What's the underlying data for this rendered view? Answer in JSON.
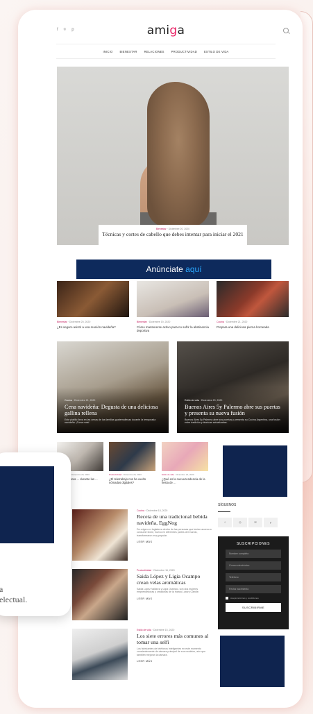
{
  "site": {
    "logo_prefix": "ami",
    "logo_accent": "g",
    "logo_suffix": "a",
    "social": [
      "f",
      "⌾",
      "p"
    ],
    "nav": [
      "INICIO",
      "BIENESTAR",
      "RELACIONES",
      "PRODUCTIVIDAD",
      "ESTILO DE VIDA"
    ]
  },
  "hero": {
    "category": "Bienestar",
    "date": "Diciembre 20, 2020",
    "title": "Técnicas y cortes de cabello que debes intentar para iniciar el 2021"
  },
  "ad_banner": {
    "text": "Anúnciate",
    "accent": "aquí"
  },
  "triple": [
    {
      "category": "Bienestar",
      "date": "Diciembre 20, 2020",
      "title": "¿Es seguro asistir a una reunión navideña?"
    },
    {
      "category": "Bienestar",
      "date": "Diciembre 19, 2020",
      "title": "Cómo mantenerse activo para no sufrir la abstinencia deportiva"
    },
    {
      "category": "Cocina",
      "date": "Diciembre 21, 2020",
      "title": "Prepara una deliciosa pierna horneada"
    }
  ],
  "big": [
    {
      "category": "Cocina",
      "date": "Diciembre 21, 2020",
      "title": "Cena navideña: Degusta de una deliciosa gallina rellena",
      "excerpt": "Este platillo lleva en las cenas de las familias guatemaltecas durante la temporada navideña. ¡Toma nota!"
    },
    {
      "category": "Estilo de vida",
      "date": "Diciembre 20, 2020",
      "title": "Buenos Aires 5y Palermo abre sus puertas y presenta su nueva fusión",
      "excerpt": "Buenos Aires 5y Palermo abre sus puertas y presenta su Cocina Argentina, una fusión entre tradición y técnicas actualizadas."
    }
  ],
  "small": [
    {
      "category": "Productividad",
      "date": "Diciembre 20, 2020",
      "title": "La familia para ... durante las ..."
    },
    {
      "category": "Productividad",
      "date": "Diciembre 20, 2020",
      "title": "¿El teletrabajo nos ha vuelto nómadas digitales?"
    },
    {
      "category": "Estilo de vida",
      "date": "Diciembre 20, 2020",
      "title": "¿Qué es la nueva tendencia de la fiesta de ..."
    }
  ],
  "articles": [
    {
      "category": "Cocina",
      "date": "Diciembre 18, 2020",
      "title": "Receta de una tradicional bebida navideña, EggNog",
      "excerpt": "De origen en Inglaterra dentro de las personas que tenían acceso a consumir leche, huevo en diferentes partes del mundo, transformaron muy popular.",
      "more": "LEER MÁS"
    },
    {
      "category": "Productividad",
      "date": "Diciembre 16, 2020",
      "title": "Saida López y Ligia Ocampo crean velas aromáticas",
      "excerpt": "Saida López Valdeza y Ligia Ocampo, son dos mujeres emprendedoras y creadoras de la marca Luxury Candle.",
      "more": "LEER MÁS"
    },
    {
      "category": "Estilo de vida",
      "date": "Diciembre 15, 2020",
      "title": "Los siete errores más comunes al tomar una selfi",
      "excerpt": "Los fabricantes de teléfonos inteligentes en este momento constantemente de cámara principal de sus modelos, aún que también mejoran la cámara.",
      "more": "LEER MÁS"
    }
  ],
  "sidebar": {
    "follow_title": "SÍGUENOS",
    "follow_icons": [
      "f",
      "◎",
      "✉",
      "p"
    ],
    "subscribe_title": "SUSCRIPCIONES",
    "fields": [
      "Nombre completo",
      "Correo electrónico",
      "Teléfono",
      "Fecha nacimiento"
    ],
    "consent": "Acepto términos y condiciones",
    "button": "SUSCRIBIRME"
  },
  "overlay": {
    "line1": "a",
    "line2": "electual."
  },
  "colors": {
    "brand_pink": "#e91e63",
    "ad_navy": "#0f244f",
    "banner_navy": "#0e2a5c",
    "banner_accent": "#2aa8ff"
  }
}
